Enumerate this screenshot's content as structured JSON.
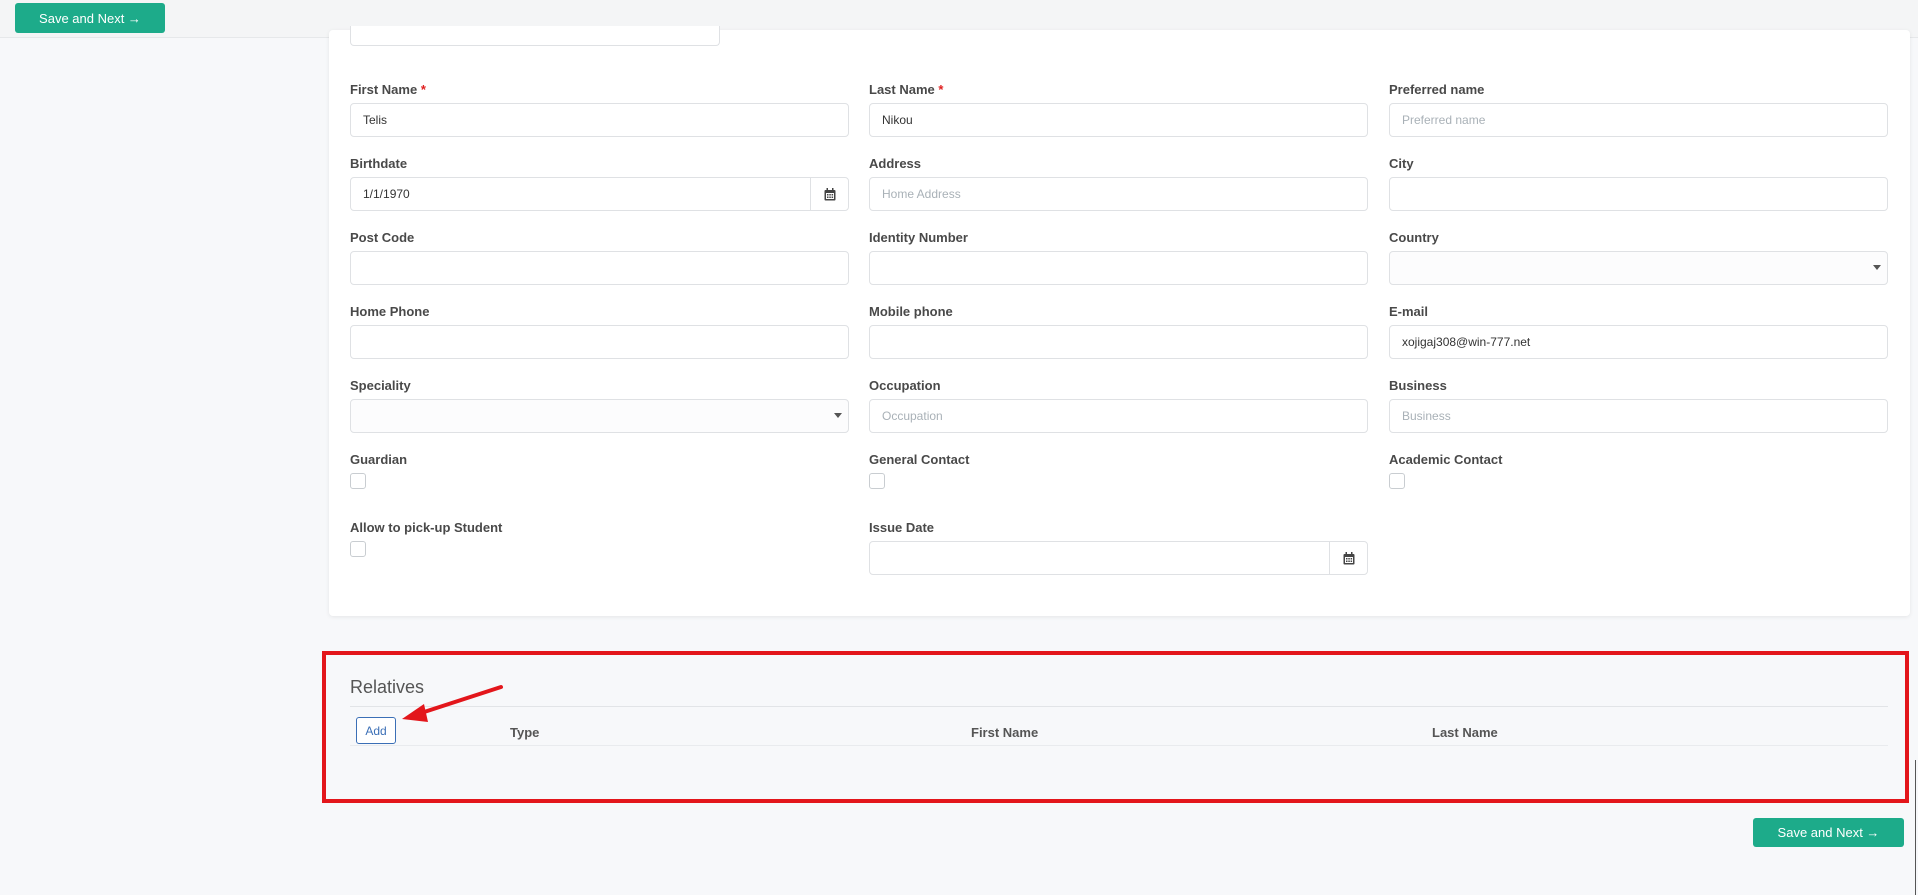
{
  "toolbar": {
    "save_next_label": "Save and Next →"
  },
  "form": {
    "first_name": {
      "label": "First Name",
      "required_mark": "*",
      "value": "Telis"
    },
    "last_name": {
      "label": "Last Name",
      "required_mark": "*",
      "value": "Nikou"
    },
    "preferred_name": {
      "label": "Preferred name",
      "placeholder": "Preferred name"
    },
    "birthdate": {
      "label": "Birthdate",
      "value": "1/1/1970"
    },
    "address": {
      "label": "Address",
      "placeholder": "Home Address"
    },
    "city": {
      "label": "City",
      "value": ""
    },
    "post_code": {
      "label": "Post Code",
      "value": ""
    },
    "identity_number": {
      "label": "Identity Number",
      "value": ""
    },
    "country": {
      "label": "Country",
      "value": ""
    },
    "home_phone": {
      "label": "Home Phone",
      "value": ""
    },
    "mobile_phone": {
      "label": "Mobile phone",
      "value": ""
    },
    "email": {
      "label": "E-mail",
      "value": "xojigaj308@win-777.net"
    },
    "speciality": {
      "label": "Speciality",
      "value": ""
    },
    "occupation": {
      "label": "Occupation",
      "placeholder": "Occupation"
    },
    "business": {
      "label": "Business",
      "placeholder": "Business"
    },
    "guardian": {
      "label": "Guardian",
      "checked": false
    },
    "general_contact": {
      "label": "General Contact",
      "checked": false
    },
    "academic_contact": {
      "label": "Academic Contact",
      "checked": false
    },
    "allow_pickup": {
      "label": "Allow to pick-up Student",
      "checked": false
    },
    "issue_date": {
      "label": "Issue Date",
      "value": ""
    }
  },
  "relatives": {
    "title": "Relatives",
    "add_label": "Add",
    "columns": [
      "Type",
      "First Name",
      "Last Name"
    ]
  },
  "colors": {
    "accent": "#1dab8a",
    "link": "#3b6fb6",
    "annotation": "#e3161b"
  },
  "icons": {
    "calendar": "calendar-icon",
    "dropdown": "chevron-down-icon"
  }
}
